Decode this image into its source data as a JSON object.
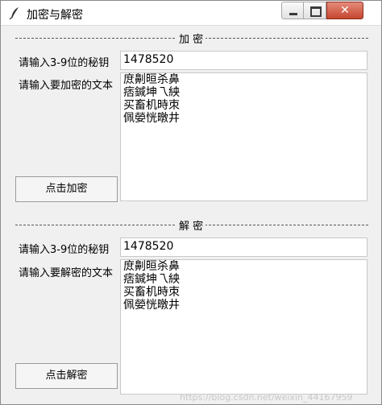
{
  "window": {
    "title": "加密与解密",
    "controls": {
      "close": "✕"
    }
  },
  "encrypt": {
    "section_title": "加 密",
    "key_label": "请输入3-9位的秘钥",
    "key_value": "1478520",
    "text_label": "请输入要加密的文本",
    "text_lines": [
      "庻劓晅杀鼻",
      "痞鍼坤乁紻",
      "买畜机時朿",
      "佩嫈恍暾井"
    ],
    "button": "点击加密"
  },
  "decrypt": {
    "section_title": "解 密",
    "key_label": "请输入3-9位的秘钥",
    "key_value": "1478520",
    "text_label": "请输入要解密的文本",
    "text_lines": [
      "庻劓晅杀鼻",
      "痞鍼坤乁紻",
      "买畜机時朿",
      "佩嫈恍暾井"
    ],
    "button": "点击解密"
  },
  "watermark": "https://blog.csdn.net/weixin_44167959"
}
